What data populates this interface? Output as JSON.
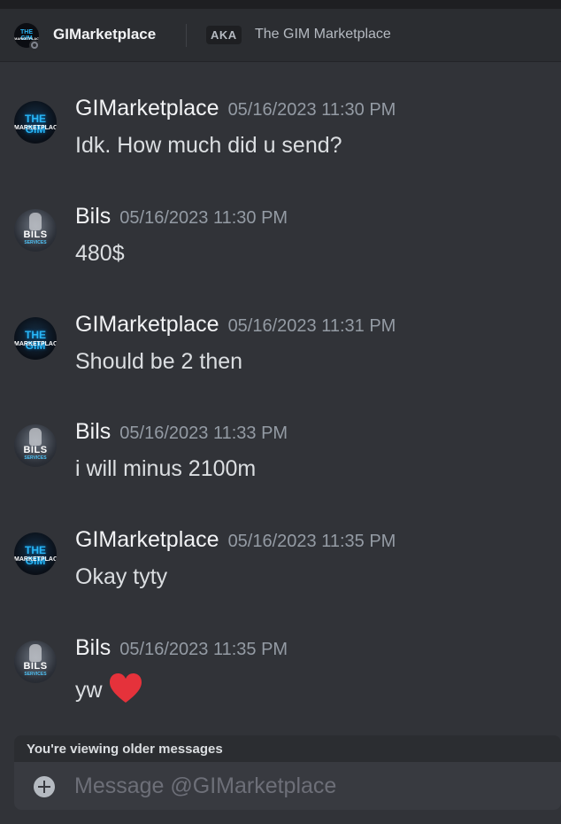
{
  "header": {
    "name": "GIMarketplace",
    "aka_label": "AKA",
    "aka_name": "The GIM Marketplace",
    "avatar_text_top": "THE GIM",
    "avatar_text_bottom": "MARKETPLACE",
    "status": "offline"
  },
  "messages": [
    {
      "author": "GIMarketplace",
      "avatar": "gim-logo",
      "timestamp": "05/16/2023 11:30 PM",
      "text": "Idk. How much did u send?"
    },
    {
      "author": "Bils",
      "avatar": "bils-logo",
      "timestamp": "05/16/2023 11:30 PM",
      "text": "480$"
    },
    {
      "author": "GIMarketplace",
      "avatar": "gim-logo",
      "timestamp": "05/16/2023 11:31 PM",
      "text": "Should be 2 then"
    },
    {
      "author": "Bils",
      "avatar": "bils-logo",
      "timestamp": "05/16/2023 11:33 PM",
      "text": "i will minus 2100m"
    },
    {
      "author": "GIMarketplace",
      "avatar": "gim-logo",
      "timestamp": "05/16/2023 11:35 PM",
      "text": "Okay tyty"
    },
    {
      "author": "Bils",
      "avatar": "bils-logo",
      "timestamp": "05/16/2023 11:35 PM",
      "text": "yw",
      "emoji": "red-heart"
    }
  ],
  "avatars": {
    "gim": {
      "line1": "THE GIM",
      "line2": "MARKETPLACE"
    },
    "bils": {
      "line1": "BILS",
      "line2": "SERVICES"
    }
  },
  "older_banner": "You're viewing older messages",
  "composer": {
    "placeholder": "Message @GIMarketplace"
  },
  "colors": {
    "background": "#313338",
    "header": "#2b2d31",
    "composer": "#383a40",
    "heart": "#e5323b",
    "gim_accent": "#29b6f6"
  }
}
